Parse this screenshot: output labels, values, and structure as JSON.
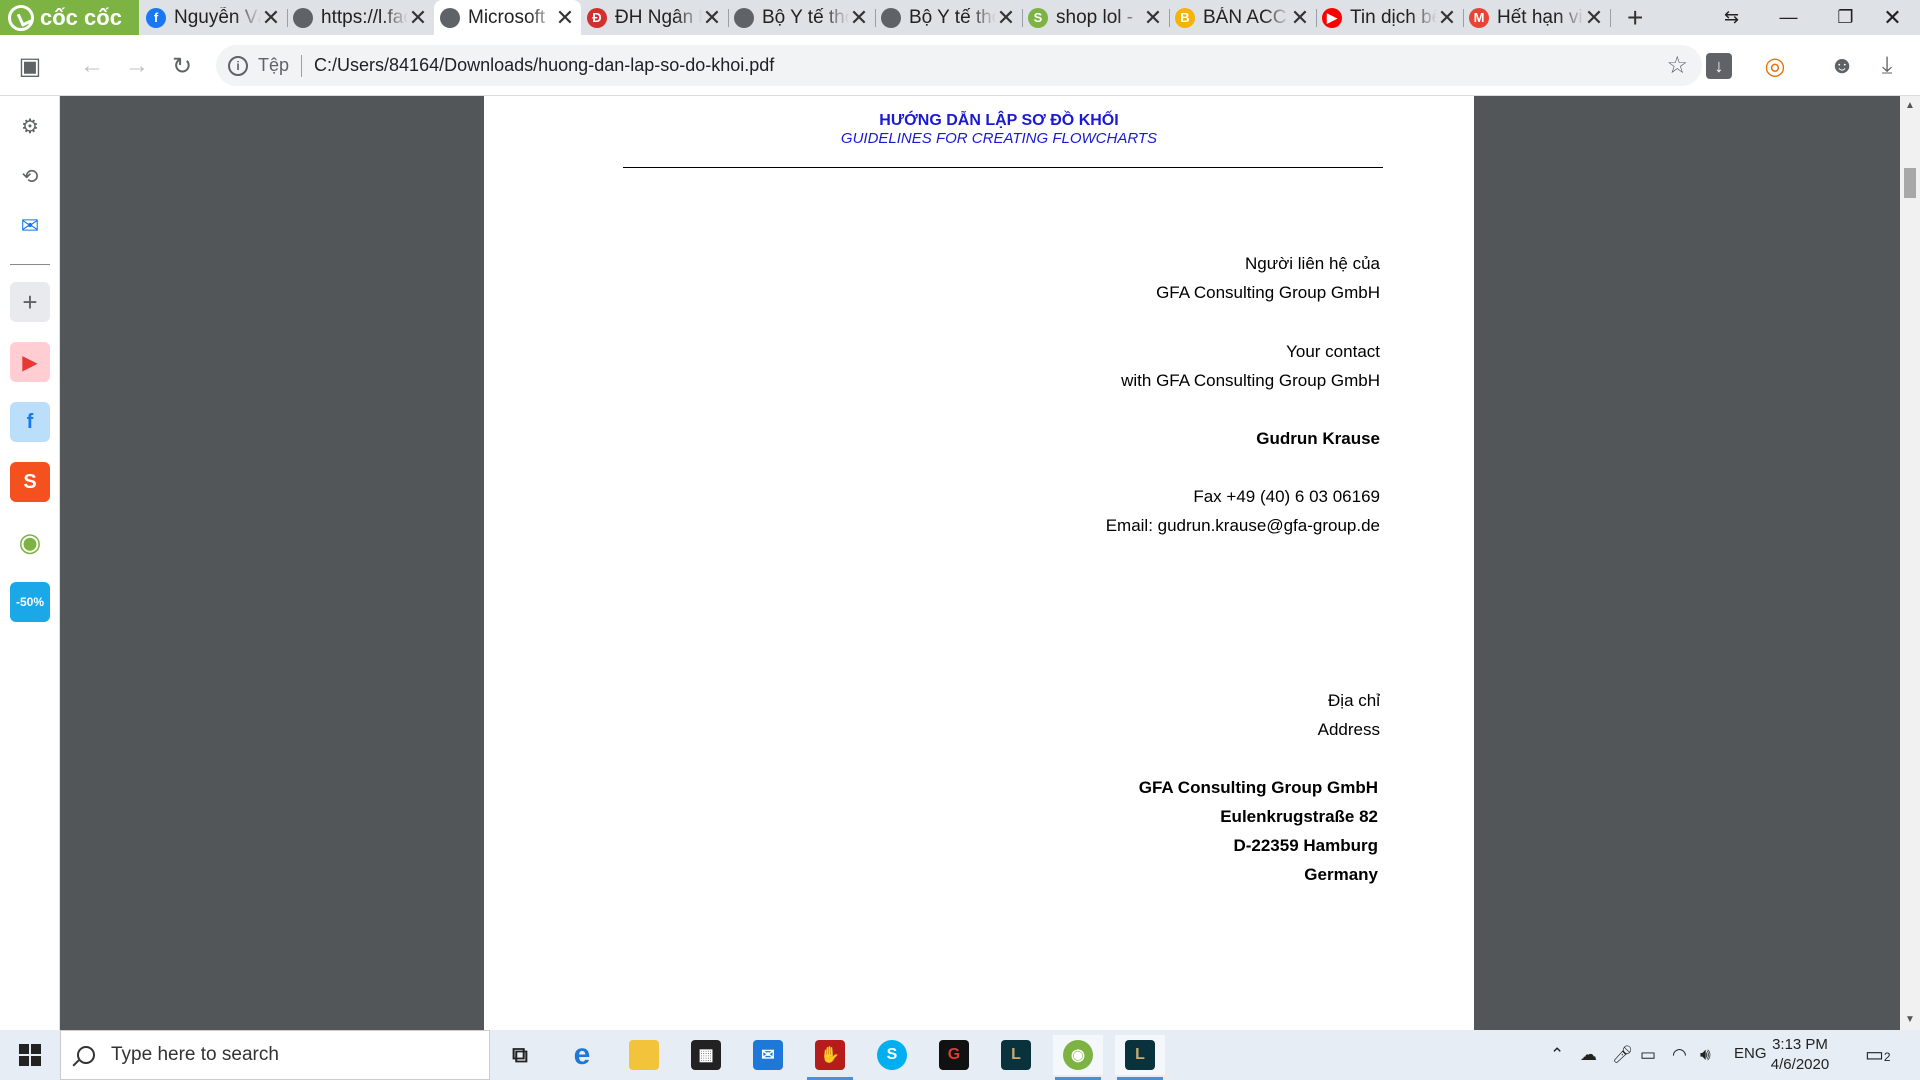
{
  "browser": {
    "brand": "cốc cốc",
    "tabs": [
      {
        "title": "Nguyễn Văn",
        "favicon": "facebook-icon",
        "color": "#1877f2",
        "glyph": "f"
      },
      {
        "title": "https://l.facebook",
        "favicon": "globe-icon",
        "color": "#5f6368",
        "glyph": ""
      },
      {
        "title": "Microsoft",
        "favicon": "globe-icon",
        "color": "#5f6368",
        "glyph": "",
        "active": true
      },
      {
        "title": "ĐH Ngân hàng",
        "favicon": "university-icon",
        "color": "#d32f2f",
        "glyph": "Đ"
      },
      {
        "title": "Bộ Y tế thông",
        "favicon": "globe-icon",
        "color": "#5f6368",
        "glyph": ""
      },
      {
        "title": "Bộ Y tế thông",
        "favicon": "globe-icon",
        "color": "#5f6368",
        "glyph": ""
      },
      {
        "title": "shop lol -",
        "favicon": "leaf-icon",
        "color": "#7cb342",
        "glyph": "S"
      },
      {
        "title": "BÁN ACC",
        "favicon": "emoji-icon",
        "color": "#f4b400",
        "glyph": "B"
      },
      {
        "title": "Tin dịch bệnh",
        "favicon": "youtube-icon",
        "color": "#ff0000",
        "glyph": "▶"
      },
      {
        "title": "Hết hạn visa",
        "favicon": "gmail-icon",
        "color": "#ea4335",
        "glyph": "M"
      }
    ],
    "address": {
      "scheme_label": "Tệp",
      "url": "C:/Users/84164/Downloads/huong-dan-lap-so-do-khoi.pdf"
    }
  },
  "document": {
    "title_vi": "HƯỚNG DẪN LẬP SƠ ĐỒ KHỐI",
    "title_en": "GUIDELINES FOR CREATING FLOWCHARTS",
    "contact_label_vi": "Người liên hệ của",
    "contact_org_vi": "GFA Consulting Group GmbH",
    "contact_label_en": "Your contact",
    "contact_org_en": "with GFA Consulting Group GmbH",
    "contact_name": "Gudrun Krause",
    "fax": "Fax +49 (40) 6 03 06169",
    "email": "Email:  gudrun.krause@gfa-group.de",
    "address_label_vi": "Địa chỉ",
    "address_label_en": "Address",
    "address_lines": [
      "GFA Consulting Group GmbH",
      "Eulenkrugstraße 82",
      "D-22359 Hamburg",
      "Germany"
    ]
  },
  "taskbar": {
    "search_placeholder": "Type here to search",
    "language": "ENG",
    "time": "3:13 PM",
    "date": "4/6/2020",
    "notification_count": "2"
  }
}
